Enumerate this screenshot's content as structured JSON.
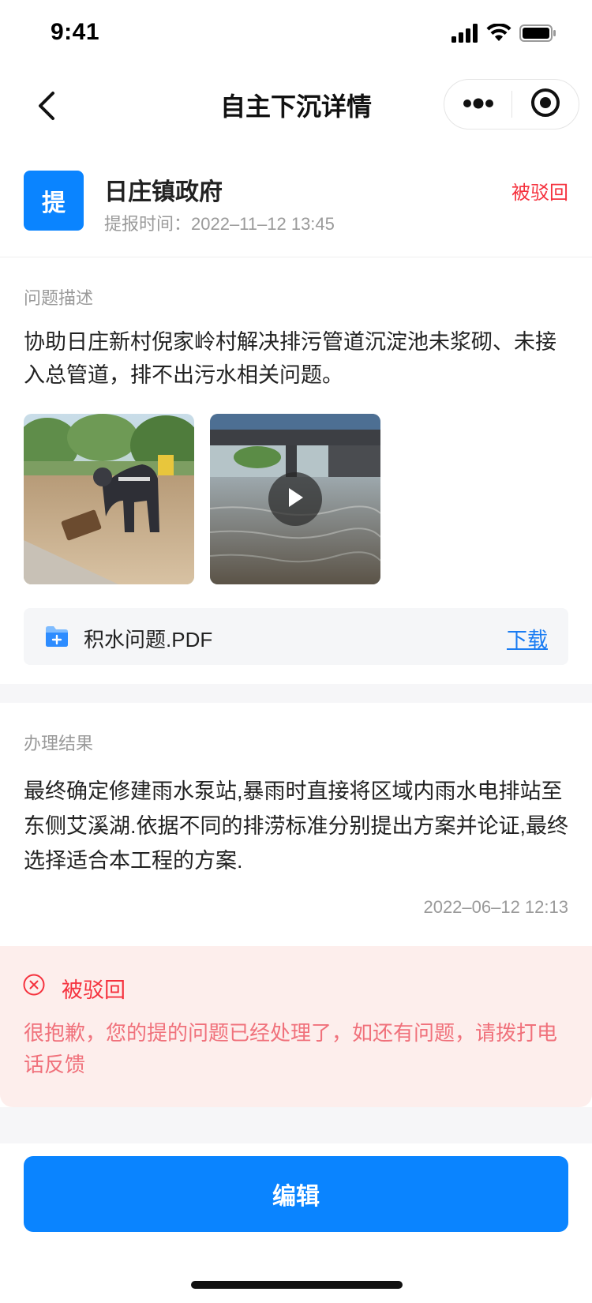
{
  "status_bar": {
    "time": "9:41",
    "signal_icon": "cellular-signal-icon",
    "wifi_icon": "wifi-icon",
    "battery_icon": "battery-icon"
  },
  "nav": {
    "title": "自主下沉详情",
    "back_icon": "chevron-left-icon",
    "more_icon": "more-dots-icon",
    "close_icon": "target-circle-icon"
  },
  "header": {
    "avatar_text": "提",
    "org_name": "日庄镇政府",
    "submit_time": "提报时间：2022–11–12 13:45",
    "status": "被驳回"
  },
  "description": {
    "label": "问题描述",
    "text": "协助日庄新村倪家岭村解决排污管道沉淀池未浆砌、未接入总管道，排不出污水相关问题。",
    "images": [
      {
        "type": "photo",
        "icon": "photo-worker-in-flood"
      },
      {
        "type": "video",
        "icon": "video-flooded-underpass",
        "play_icon": "play-icon"
      }
    ],
    "attachment": {
      "name": "积水问题.PDF",
      "icon": "folder-file-icon",
      "download_label": "下载"
    }
  },
  "result": {
    "label": "办理结果",
    "text": "最终确定修建雨水泵站,暴雨时直接将区域内雨水电排站至东侧艾溪湖.依据不同的排涝标准分别提出方案并论证,最终选择适合本工程的方案.",
    "time": "2022–06–12 12:13"
  },
  "rejection": {
    "title": "被驳回",
    "icon": "close-circle-icon",
    "message": "很抱歉，您的提的问题已经处理了，如还有问题，请拨打电话反馈"
  },
  "actions": {
    "edit_label": "编辑"
  },
  "colors": {
    "primary": "#0a84ff",
    "danger": "#f5313d",
    "danger_bg": "#fdeeec",
    "muted": "#9a9a9a",
    "link": "#1a7cf2"
  }
}
